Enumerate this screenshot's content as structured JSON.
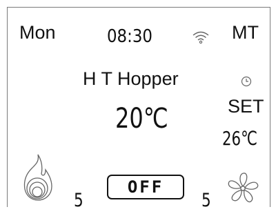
{
  "status": {
    "day": "Mon",
    "time": "08:30",
    "mode": "MT",
    "wifi_icon": "wifi-icon",
    "clock_icon": "clock-icon"
  },
  "device": {
    "name": "H T Hopper"
  },
  "temperature": {
    "current": "20℃",
    "set_label": "SET",
    "set_value": "26℃"
  },
  "controls": {
    "heat_icon": "flame-icon",
    "heat_level": "5",
    "power_label": "OFF",
    "fan_icon": "fan-icon",
    "fan_level": "5"
  },
  "colors": {
    "foreground": "#111111",
    "background": "#ffffff",
    "icon_stroke": "#666666"
  }
}
